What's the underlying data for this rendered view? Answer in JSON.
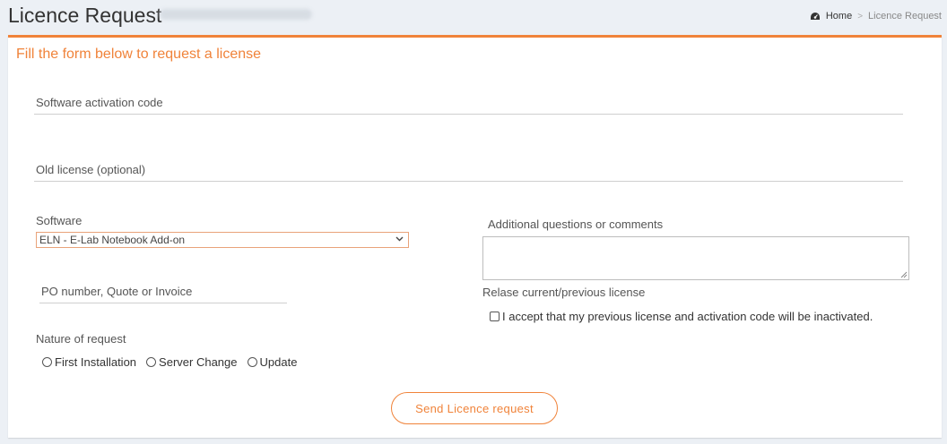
{
  "header": {
    "title": "Licence Request",
    "breadcrumb": {
      "home": "Home",
      "separator": ">",
      "current": "Licence Request"
    }
  },
  "form": {
    "heading": "Fill the form below to request a license",
    "activation_code": {
      "placeholder": "Software activation code",
      "value": ""
    },
    "old_license": {
      "placeholder": "Old license (optional)",
      "value": ""
    },
    "software": {
      "label": "Software",
      "selected": "ELN - E-Lab Notebook Add-on"
    },
    "po_number": {
      "placeholder": "PO number, Quote or Invoice",
      "value": ""
    },
    "nature": {
      "label": "Nature of request",
      "options": [
        "First Installation",
        "Server Change",
        "Update"
      ]
    },
    "comments": {
      "label": "Additional questions or comments",
      "value": ""
    },
    "release": {
      "label": "Relase current/previous license",
      "checkbox_label": "I accept that my previous license and activation code will be inactivated."
    },
    "submit_label": "Send Licence request"
  },
  "colors": {
    "accent": "#f0833a",
    "background": "#ecf0f5"
  },
  "icons": {
    "home": "dashboard-icon",
    "dropdown": "chevron-down-icon"
  }
}
